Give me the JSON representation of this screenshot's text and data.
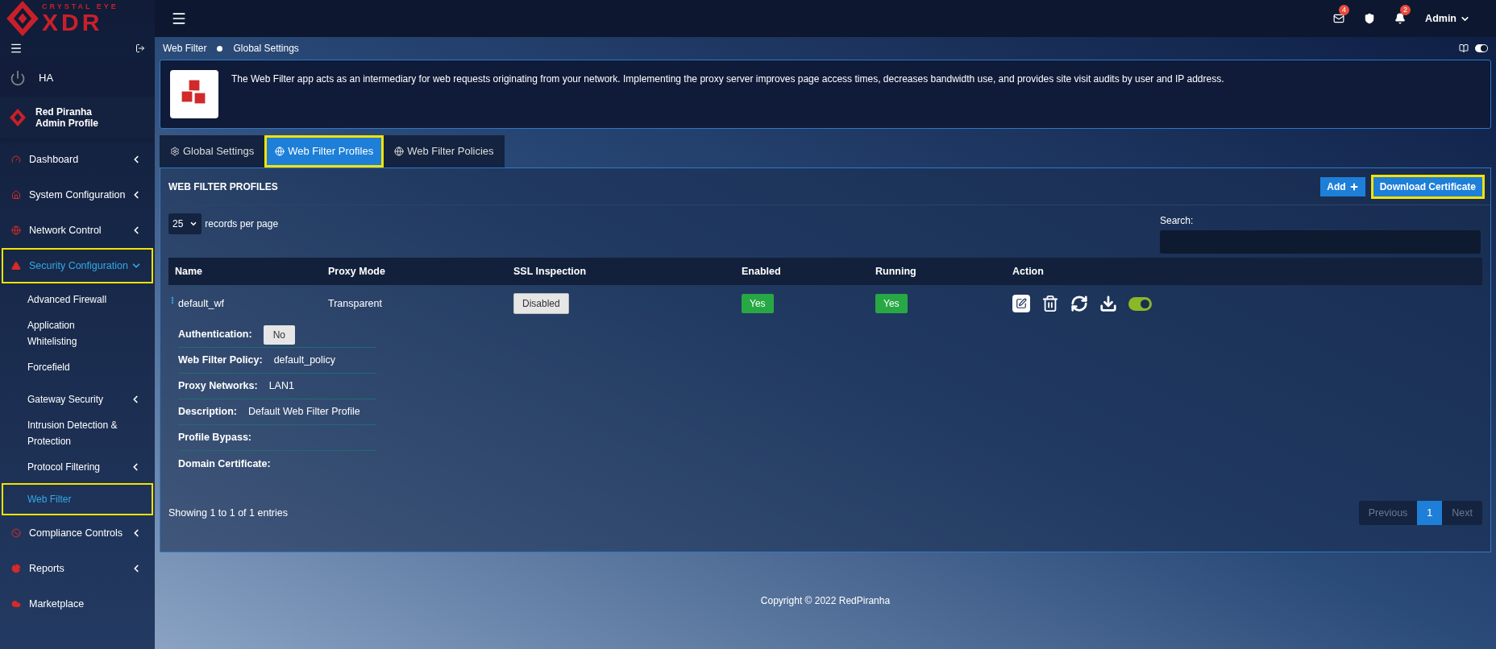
{
  "logo": {
    "top": "CRYSTAL EYE",
    "main": "XDR"
  },
  "topbar": {
    "badges": [
      {
        "kind": "mail",
        "count": "4"
      },
      {
        "kind": "shield"
      },
      {
        "kind": "bell",
        "count": "2"
      }
    ],
    "user": "Admin"
  },
  "sidebar": {
    "ha": "HA",
    "profile": {
      "name": "Red Piranha",
      "role": "Admin Profile"
    },
    "items": [
      {
        "label": "Dashboard",
        "expandable": true,
        "expanded": false,
        "selected": false,
        "highlighted": false
      },
      {
        "label": "System Configuration",
        "expandable": true,
        "expanded": false,
        "selected": false,
        "highlighted": false
      },
      {
        "label": "Network Control",
        "expandable": true,
        "expanded": false,
        "selected": false,
        "highlighted": false
      },
      {
        "label": "Security Configuration",
        "expandable": true,
        "expanded": true,
        "selected": true,
        "highlighted": true,
        "children": [
          {
            "label": "Advanced Firewall",
            "expandable": false,
            "selected": false,
            "highlighted": false
          },
          {
            "label": "Application Whitelisting",
            "expandable": false,
            "selected": false,
            "highlighted": false
          },
          {
            "label": "Forcefield",
            "expandable": false,
            "selected": false,
            "highlighted": false
          },
          {
            "label": "Gateway Security",
            "expandable": true,
            "selected": false,
            "highlighted": false
          },
          {
            "label": "Intrusion Detection & Protection",
            "expandable": false,
            "selected": false,
            "highlighted": false
          },
          {
            "label": "Protocol Filtering",
            "expandable": true,
            "selected": false,
            "highlighted": false
          },
          {
            "label": "Web Filter",
            "expandable": false,
            "selected": true,
            "highlighted": true
          }
        ]
      },
      {
        "label": "Compliance Controls",
        "expandable": true,
        "expanded": false,
        "selected": false,
        "highlighted": false
      },
      {
        "label": "Reports",
        "expandable": true,
        "expanded": false,
        "selected": false,
        "highlighted": false
      },
      {
        "label": "Marketplace",
        "expandable": false,
        "expanded": false,
        "selected": false,
        "highlighted": false
      }
    ]
  },
  "breadcrumb": [
    "Web Filter",
    "Global Settings"
  ],
  "info": "The Web Filter app acts as an intermediary for web requests originating from your network. Implementing the proxy server improves page access times, decreases bandwidth use, and provides site visit audits by user and IP address.",
  "tabs": [
    {
      "label": "Global Settings",
      "selected": false,
      "highlighted": false
    },
    {
      "label": "Web Filter Profiles",
      "selected": true,
      "highlighted": true
    },
    {
      "label": "Web Filter Policies",
      "selected": false,
      "highlighted": false
    }
  ],
  "panel": {
    "title": "WEB FILTER PROFILES",
    "buttons": [
      {
        "label": "Add",
        "highlighted": false
      },
      {
        "label": "Download Certificate",
        "highlighted": true
      }
    ],
    "page_size": "25",
    "page_size_label": "records per page",
    "search_label": "Search:",
    "table": {
      "columns": [
        "Name",
        "Proxy Mode",
        "SSL Inspection",
        "Enabled",
        "Running",
        "Action"
      ],
      "rows": [
        {
          "name": "default_wf",
          "proxy_mode": "Transparent",
          "ssl": {
            "label": "Disabled",
            "on": false
          },
          "enabled": {
            "label": "Yes",
            "on": true
          },
          "running": {
            "label": "Yes",
            "on": true
          },
          "toggle_on": true,
          "details": [
            {
              "label": "Authentication:",
              "value": "No",
              "kind": "badge"
            },
            {
              "label": "Web Filter Policy:",
              "value": "default_policy",
              "kind": "text"
            },
            {
              "label": "Proxy Networks:",
              "value": "LAN1",
              "kind": "text"
            },
            {
              "label": "Description:",
              "value": "Default Web Filter Profile",
              "kind": "text"
            },
            {
              "label": "Profile Bypass:"
            },
            {
              "label": "Domain Certificate:"
            }
          ]
        }
      ]
    },
    "showing": "Showing 1 to 1 of 1 entries",
    "pagination": [
      {
        "label": "Previous",
        "selected": false,
        "disabled": true
      },
      {
        "label": "1",
        "selected": true,
        "disabled": false
      },
      {
        "label": "Next",
        "selected": false,
        "disabled": true
      }
    ]
  },
  "footer": "Copyright © 2022 RedPiranha"
}
